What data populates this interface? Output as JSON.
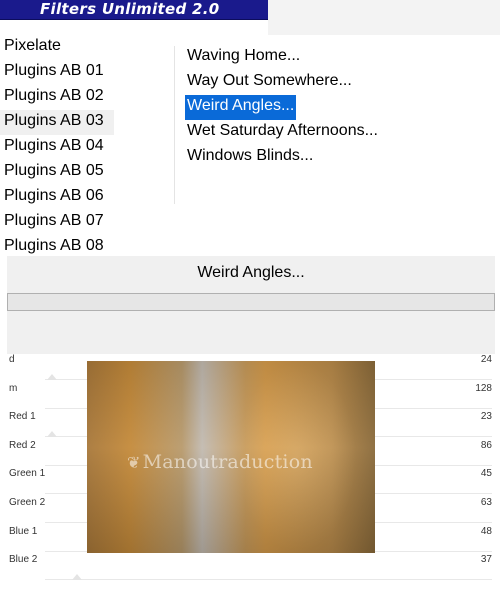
{
  "window": {
    "title": "Filters Unlimited 2.0"
  },
  "categories": {
    "items": [
      "Pixelate",
      "Plugins AB 01",
      "Plugins AB 02",
      "Plugins AB 03",
      "Plugins AB 04",
      "Plugins AB 05",
      "Plugins AB 06",
      "Plugins AB 07",
      "Plugins AB 08"
    ],
    "selected_index": 3
  },
  "filters": {
    "items": [
      "Waving Home...",
      "Way Out Somewhere...",
      "Weird Angles...",
      "Wet Saturday Afternoons...",
      "Windows Blinds..."
    ],
    "selected_index": 2
  },
  "panel": {
    "filter_name": "Weird Angles..."
  },
  "sliders": [
    {
      "label": "d",
      "value": "24"
    },
    {
      "label": "m",
      "value": "128"
    },
    {
      "label": "Red 1",
      "value": "23"
    },
    {
      "label": "Red 2",
      "value": "86"
    },
    {
      "label": "Green 1",
      "value": "45"
    },
    {
      "label": "Green 2",
      "value": "63"
    },
    {
      "label": "Blue 1",
      "value": "48"
    },
    {
      "label": "Blue 2",
      "value": "37"
    }
  ],
  "preview": {
    "watermark": "Manoutraduction"
  },
  "colors": {
    "title_bar": "#1a1a8c",
    "selection": "#0a6ad8",
    "panel": "#f0f0f0"
  }
}
